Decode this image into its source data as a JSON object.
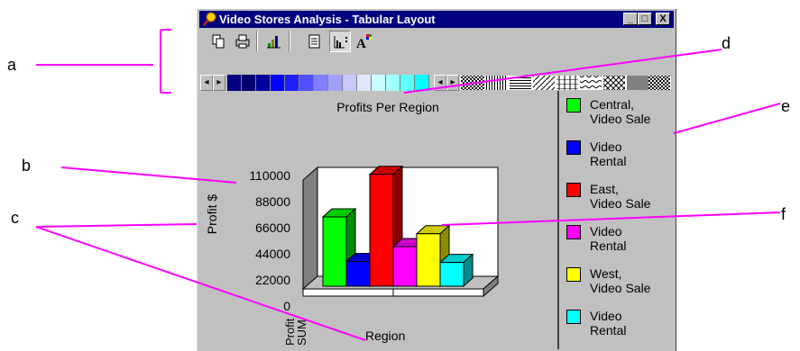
{
  "window": {
    "title": "Video Stores Analysis - Tabular Layout"
  },
  "title_buttons": {
    "minimize": "_",
    "maximize": "□",
    "close": "X"
  },
  "chart_data": {
    "type": "bar",
    "title": "Profits Per Region",
    "xlabel": "Region",
    "ylabel": "Profit $",
    "ylim": [
      0,
      110000
    ],
    "yticks": [
      "110000",
      "88000",
      "66000",
      "44000",
      "22000",
      "0"
    ],
    "categories": [
      "Profit SUM"
    ],
    "category_label_lines": [
      "Profit",
      "SUM"
    ],
    "series": [
      {
        "name": "Central, Video Sale",
        "values": [
          70000
        ],
        "color": "#00ff00"
      },
      {
        "name": "Video Rental",
        "values": [
          25000
        ],
        "color": "#0000ff"
      },
      {
        "name": "East, Video Sale",
        "values": [
          113000
        ],
        "color": "#ff0000"
      },
      {
        "name": "Video Rental",
        "values": [
          40000
        ],
        "color": "#ff00ff"
      },
      {
        "name": "West, Video Sale",
        "values": [
          53000
        ],
        "color": "#ffff00"
      },
      {
        "name": "Video Rental",
        "values": [
          24000
        ],
        "color": "#00ffff"
      }
    ]
  },
  "legend": [
    {
      "line1": "Central,",
      "line2": "Video Sale",
      "color": "#00ff00"
    },
    {
      "line1": "Video",
      "line2": "Rental",
      "color": "#0000ff"
    },
    {
      "line1": "East,",
      "line2": "Video Sale",
      "color": "#ff0000"
    },
    {
      "line1": "Video",
      "line2": "Rental",
      "color": "#ff00ff"
    },
    {
      "line1": "West,",
      "line2": "Video Sale",
      "color": "#ffff00"
    },
    {
      "line1": "Video",
      "line2": "Rental",
      "color": "#00ffff"
    }
  ],
  "callouts": {
    "a": "a",
    "b": "b",
    "c": "c",
    "d": "d",
    "e": "e",
    "f": "f"
  },
  "callout_color": "#ff00ff",
  "palette_colors": [
    "#000080",
    "#000070",
    "#0000a0",
    "#0000ff",
    "#2020ff",
    "#5050ff",
    "#8080ff",
    "#a0a0ff",
    "#c8c8ff",
    "#e0e8ff",
    "#c8ffff",
    "#a0ffff",
    "#60ffff",
    "#00ffff"
  ]
}
